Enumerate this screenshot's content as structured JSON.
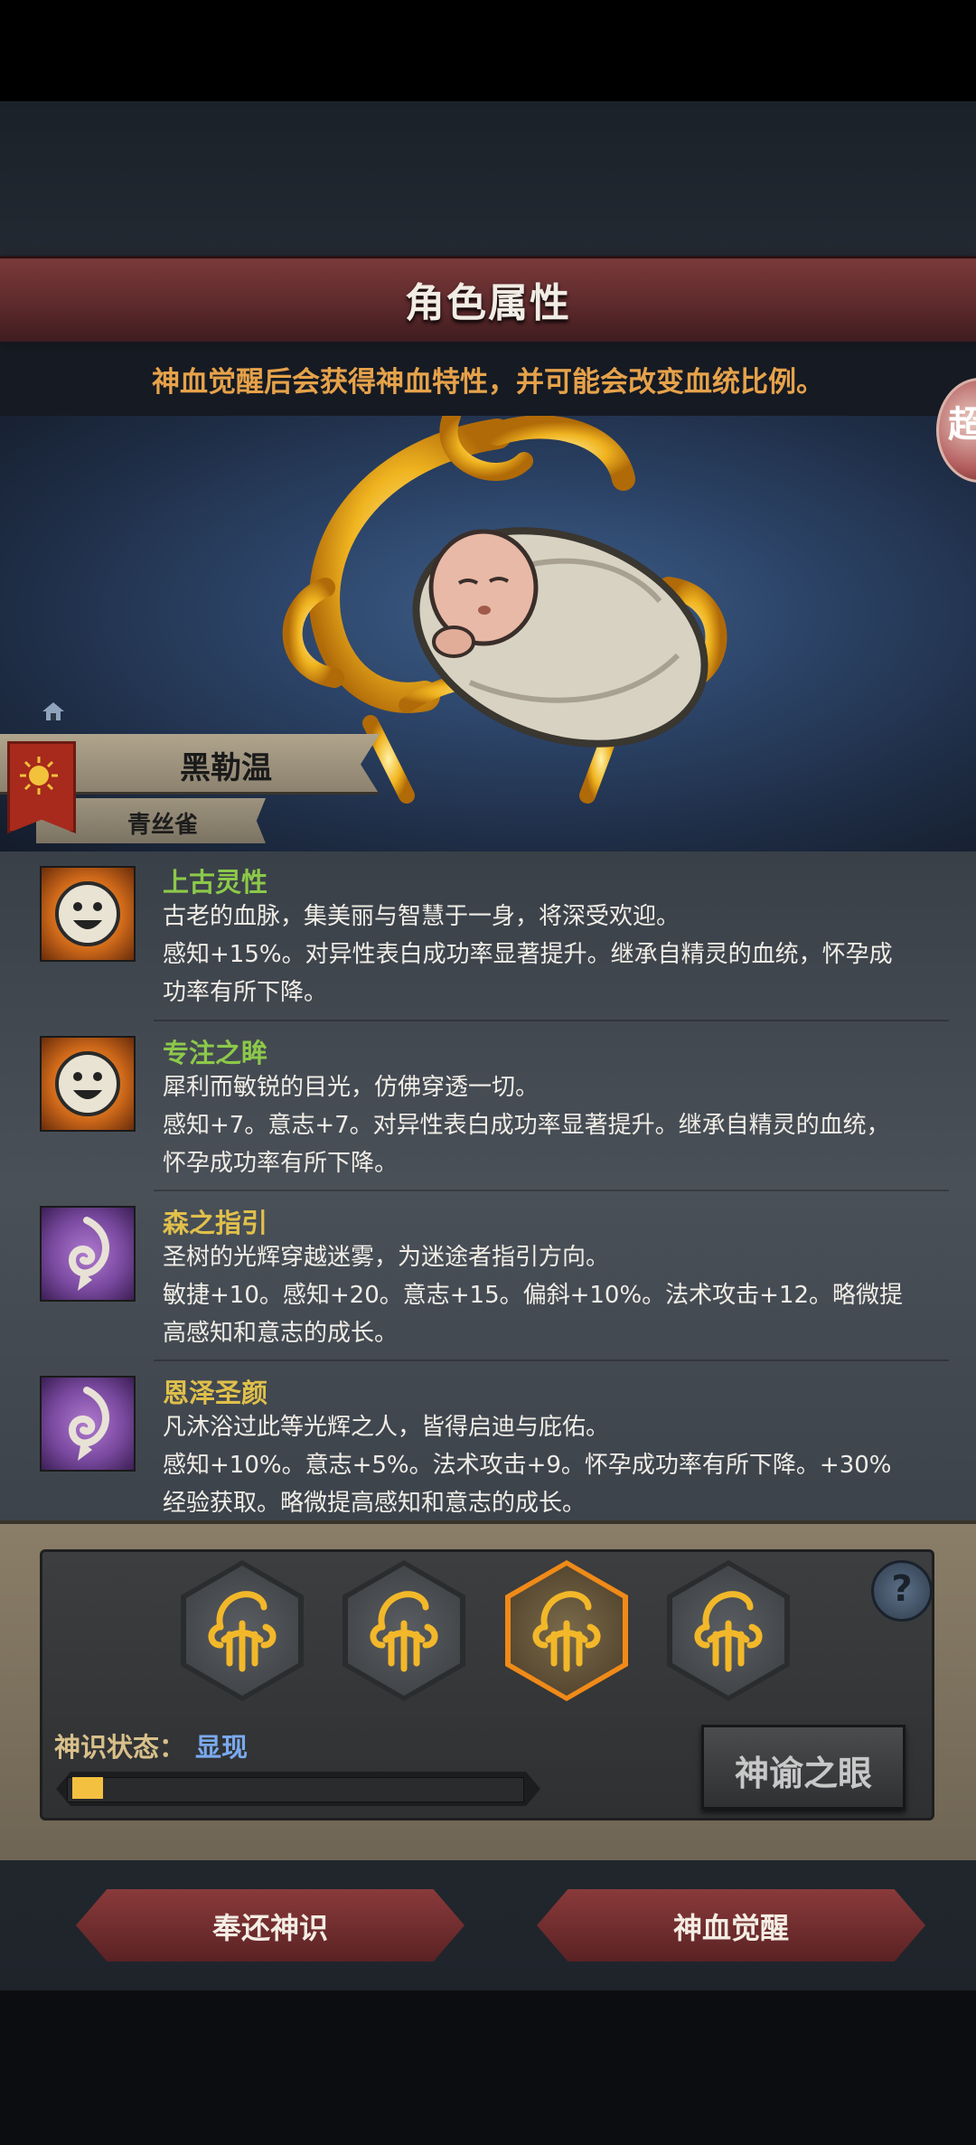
{
  "header": {
    "title": "角色属性",
    "subtitle": "神血觉醒后会获得神血特性，并可能会改变血统比例。",
    "side_badge": "超"
  },
  "character": {
    "name": "黑勒温",
    "title": "青丝雀"
  },
  "traits": [
    {
      "name": "上古灵性",
      "color": "#8cc94a",
      "icon": "smile-face-icon",
      "desc": "古老的血脉，集美丽与智慧于一身，将深受欢迎。",
      "effect_line1": "感知+15%。对异性表白成功率显著提升。继承自精灵的血统，怀孕成",
      "effect_line2": "功率有所下降。"
    },
    {
      "name": "专注之眸",
      "color": "#8cc94a",
      "icon": "smile-face-icon",
      "desc": "犀利而敏锐的目光，仿佛穿透一切。",
      "effect_line1": "感知+7。意志+7。对异性表白成功率显著提升。继承自精灵的血统，",
      "effect_line2": "怀孕成功率有所下降。"
    },
    {
      "name": "森之指引",
      "color": "#e0c04a",
      "icon": "spiral-leaf-icon",
      "desc": "圣树的光辉穿越迷雾，为迷途者指引方向。",
      "effect_line1": "敏捷+10。感知+20。意志+15。偏斜+10%。法术攻击+12。略微提",
      "effect_line2": "高感知和意志的成长。"
    },
    {
      "name": "恩泽圣颜",
      "color": "#e0c04a",
      "icon": "spiral-leaf-icon",
      "desc": "凡沐浴过此等光辉之人，皆得启迪与庇佑。",
      "effect_line1": "感知+10%。意志+5%。法术攻击+9。怀孕成功率有所下降。+30%",
      "effect_line2": "经验获取。略微提高感知和意志的成长。"
    }
  ],
  "awakening": {
    "selected_slot": 3,
    "state_label": "神识状态：",
    "state_value": "显现",
    "progress": 0.05,
    "oracle_button": "神谕之眼",
    "help": "?"
  },
  "buttons": {
    "return": "奉还神识",
    "awaken": "神血觉醒"
  }
}
